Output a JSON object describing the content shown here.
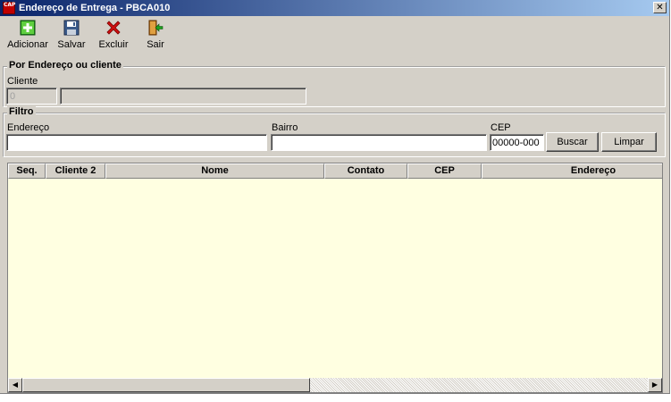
{
  "window": {
    "title": "Endereço de Entrega - PBCA010",
    "app_icon_text": "CAP"
  },
  "toolbar": {
    "add_label": "Adicionar",
    "save_label": "Salvar",
    "delete_label": "Excluir",
    "exit_label": "Sair"
  },
  "group_cliente": {
    "title": "Por Endereço ou cliente",
    "cliente_label": "Cliente",
    "cliente_code_value": "0",
    "cliente_name_value": ""
  },
  "group_filtro": {
    "title": "Filtro",
    "endereco_label": "Endereço",
    "endereco_value": "",
    "bairro_label": "Bairro",
    "bairro_value": "",
    "cep_label": "CEP",
    "cep_value": "00000-000",
    "buscar_label": "Buscar",
    "limpar_label": "Limpar"
  },
  "grid": {
    "columns": [
      "Seq.",
      "Cliente 2",
      "Nome",
      "Contato",
      "CEP",
      "Endereço"
    ],
    "rows": []
  },
  "icons": {
    "add": "add-icon",
    "save": "floppy-disk-icon",
    "delete": "red-x-icon",
    "exit": "exit-door-icon"
  }
}
